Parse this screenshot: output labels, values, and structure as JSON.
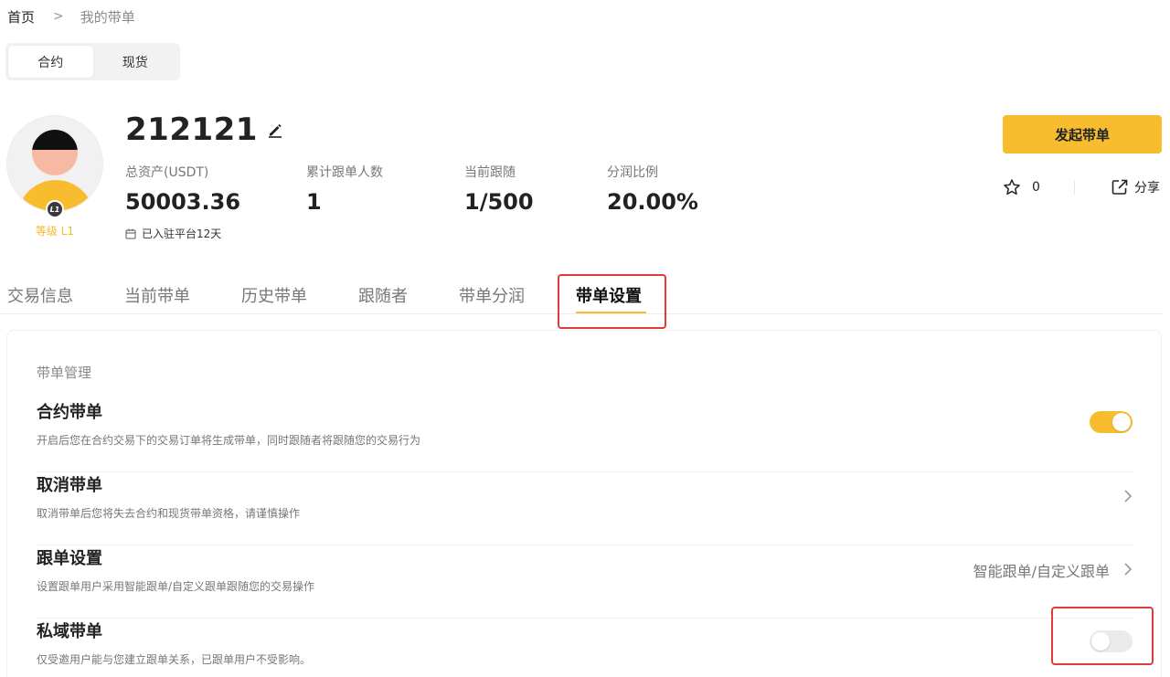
{
  "breadcrumb": {
    "home": "首页",
    "separator": ">",
    "current": "我的带单"
  },
  "segment": {
    "options": [
      "合约",
      "现货"
    ],
    "selected": "合约"
  },
  "profile": {
    "username": "212121",
    "level_badge": "L1",
    "level_text": "等级 L1",
    "joined_text": "已入驻平台12天",
    "stats": [
      {
        "label": "总资产(USDT)",
        "value": "50003.36"
      },
      {
        "label": "累计跟单人数",
        "value": "1"
      },
      {
        "label": "当前跟随",
        "value": "1/500"
      },
      {
        "label": "分润比例",
        "value": "20.00%"
      }
    ]
  },
  "actions": {
    "start_label": "发起带单",
    "favorite_count": "0",
    "share_label": "分享"
  },
  "tabs": [
    {
      "label": "交易信息",
      "active": false
    },
    {
      "label": "当前带单",
      "active": false
    },
    {
      "label": "历史带单",
      "active": false
    },
    {
      "label": "跟随者",
      "active": false
    },
    {
      "label": "带单分润",
      "active": false
    },
    {
      "label": "带单设置",
      "active": true
    }
  ],
  "settings": {
    "section_title": "带单管理",
    "rows": [
      {
        "title": "合约带单",
        "desc": "开启后您在合约交易下的交易订单将生成带单，同时跟随者将跟随您的交易行为",
        "control": "toggle",
        "on": true
      },
      {
        "title": "取消带单",
        "desc": "取消带单后您将失去合约和现货带单资格，请谨慎操作",
        "control": "chevron"
      },
      {
        "title": "跟单设置",
        "desc": "设置跟单用户采用智能跟单/自定义跟单跟随您的交易操作",
        "control": "chevron",
        "value": "智能跟单/自定义跟单"
      },
      {
        "title": "私域带单",
        "desc": "仅受邀用户能与您建立跟单关系，已跟单用户不受影响。",
        "control": "toggle",
        "on": false
      }
    ]
  },
  "colors": {
    "accent": "#f7bd2f",
    "highlight": "#e03a3a",
    "level": "#f5b82e"
  }
}
